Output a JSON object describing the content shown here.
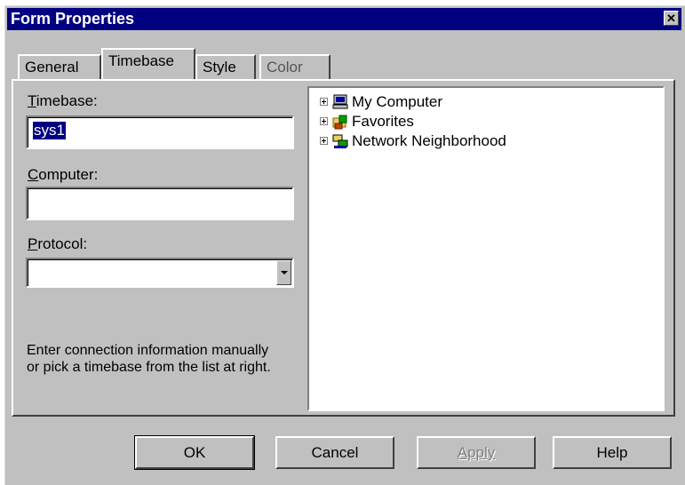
{
  "window": {
    "title": "Form Properties",
    "close_glyph": "✕"
  },
  "tabs": [
    {
      "label": "General",
      "active": false
    },
    {
      "label": "Timebase",
      "active": true
    },
    {
      "label": "Style",
      "active": false
    },
    {
      "label": "Color",
      "active": false
    }
  ],
  "form": {
    "timebase_label_mnemonic": "T",
    "timebase_label_rest": "imebase:",
    "timebase_value": "sys1",
    "computer_label_mnemonic": "C",
    "computer_label_rest": "omputer:",
    "computer_value": "",
    "protocol_label_mnemonic": "P",
    "protocol_label_rest": "rotocol:",
    "protocol_value": "",
    "help_text": "Enter connection information manually or pick a timebase from the list at right."
  },
  "tree": {
    "items": [
      {
        "label": "My Computer",
        "icon": "computer-icon"
      },
      {
        "label": "Favorites",
        "icon": "favorites-icon"
      },
      {
        "label": "Network Neighborhood",
        "icon": "network-icon"
      }
    ]
  },
  "buttons": {
    "ok": "OK",
    "cancel": "Cancel",
    "apply": "Apply",
    "help": "Help"
  }
}
